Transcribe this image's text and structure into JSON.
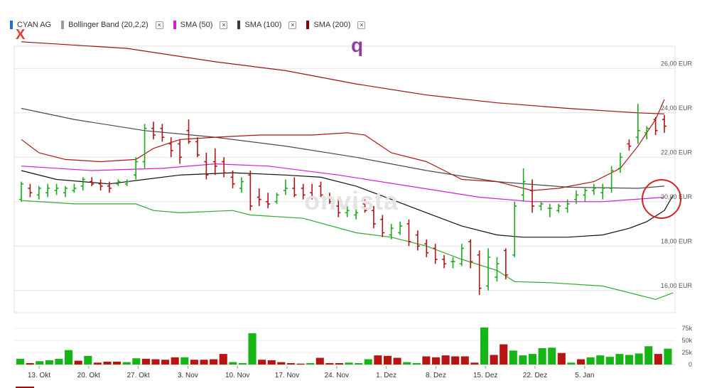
{
  "legend": [
    {
      "label": "CYAN AG",
      "color": "#1f6fd1",
      "closable": false
    },
    {
      "label": "Bollinger Band (20,2,2)",
      "color": "#9e9e9e",
      "closable": true
    },
    {
      "label": "SMA (50)",
      "color": "#d61ad6",
      "closable": true
    },
    {
      "label": "SMA (100)",
      "color": "#3a3a3a",
      "closable": true
    },
    {
      "label": "SMA (200)",
      "color": "#8b0000",
      "closable": true
    }
  ],
  "close_symbol": "×",
  "annotations": {
    "x_mark": "X",
    "q_mark": "q"
  },
  "watermark": "onvista",
  "chart_data": {
    "type": "ohlc",
    "y_axis": {
      "unit": "EUR",
      "ticks": [
        "26,00 EUR",
        "24,00 EUR",
        "22,00 EUR",
        "20,00 EUR",
        "18,00 EUR",
        "16,00 EUR"
      ],
      "range": [
        15.0,
        27.0
      ]
    },
    "volume_axis": {
      "ticks": [
        "75k",
        "50k",
        "25k",
        "0"
      ],
      "range": [
        0,
        90000
      ]
    },
    "x_labels": [
      "13. Okt",
      "20. Okt",
      "27. Okt",
      "3. Nov",
      "10. Nov",
      "17. Nov",
      "24. Nov",
      "1. Dez",
      "8. Dez",
      "15. Dez",
      "22. Dez",
      "5. Jan"
    ],
    "bars": [
      {
        "o": 20.1,
        "h": 20.9,
        "l": 20.0,
        "c": 20.8
      },
      {
        "o": 20.6,
        "h": 20.8,
        "l": 20.2,
        "c": 20.4
      },
      {
        "o": 20.3,
        "h": 20.7,
        "l": 20.1,
        "c": 20.6
      },
      {
        "o": 20.4,
        "h": 20.8,
        "l": 20.2,
        "c": 20.6
      },
      {
        "o": 20.5,
        "h": 20.8,
        "l": 20.3,
        "c": 20.6
      },
      {
        "o": 20.4,
        "h": 20.7,
        "l": 20.2,
        "c": 20.6
      },
      {
        "o": 20.5,
        "h": 20.8,
        "l": 20.4,
        "c": 20.6
      },
      {
        "o": 20.7,
        "h": 21.1,
        "l": 20.5,
        "c": 21.0
      },
      {
        "o": 20.9,
        "h": 21.1,
        "l": 20.7,
        "c": 20.8
      },
      {
        "o": 20.8,
        "h": 21.0,
        "l": 20.5,
        "c": 20.7
      },
      {
        "o": 20.7,
        "h": 20.9,
        "l": 20.4,
        "c": 20.6
      },
      {
        "o": 20.8,
        "h": 21.0,
        "l": 20.7,
        "c": 20.9
      },
      {
        "o": 20.8,
        "h": 21.0,
        "l": 20.7,
        "c": 20.9
      },
      {
        "o": 21.2,
        "h": 22.0,
        "l": 21.0,
        "c": 21.8
      },
      {
        "o": 21.8,
        "h": 23.5,
        "l": 21.5,
        "c": 23.3
      },
      {
        "o": 23.3,
        "h": 23.6,
        "l": 22.8,
        "c": 23.0
      },
      {
        "o": 23.3,
        "h": 23.5,
        "l": 22.7,
        "c": 22.9
      },
      {
        "o": 22.6,
        "h": 22.9,
        "l": 22.0,
        "c": 22.3
      },
      {
        "o": 22.6,
        "h": 22.8,
        "l": 21.7,
        "c": 22.0
      },
      {
        "o": 23.2,
        "h": 23.7,
        "l": 22.6,
        "c": 22.7
      },
      {
        "o": 22.7,
        "h": 22.9,
        "l": 22.0,
        "c": 22.1
      },
      {
        "o": 21.8,
        "h": 22.2,
        "l": 21.0,
        "c": 21.2
      },
      {
        "o": 21.8,
        "h": 22.4,
        "l": 21.2,
        "c": 21.6
      },
      {
        "o": 21.8,
        "h": 22.0,
        "l": 21.1,
        "c": 21.3
      },
      {
        "o": 21.1,
        "h": 21.4,
        "l": 20.6,
        "c": 20.8
      },
      {
        "o": 20.6,
        "h": 21.1,
        "l": 20.4,
        "c": 20.9
      },
      {
        "o": 21.2,
        "h": 21.4,
        "l": 19.6,
        "c": 19.8
      },
      {
        "o": 20.2,
        "h": 20.6,
        "l": 19.8,
        "c": 20.1
      },
      {
        "o": 20.0,
        "h": 20.4,
        "l": 19.7,
        "c": 19.9
      },
      {
        "o": 20.0,
        "h": 20.4,
        "l": 19.9,
        "c": 20.3
      },
      {
        "o": 20.5,
        "h": 21.0,
        "l": 20.3,
        "c": 20.6
      },
      {
        "o": 20.6,
        "h": 21.1,
        "l": 20.2,
        "c": 20.3
      },
      {
        "o": 20.6,
        "h": 20.8,
        "l": 20.1,
        "c": 20.3
      },
      {
        "o": 20.4,
        "h": 20.8,
        "l": 20.1,
        "c": 20.2
      },
      {
        "o": 20.7,
        "h": 20.9,
        "l": 20.2,
        "c": 20.3
      },
      {
        "o": 20.2,
        "h": 20.4,
        "l": 19.9,
        "c": 20.0
      },
      {
        "o": 19.8,
        "h": 20.2,
        "l": 19.3,
        "c": 19.5
      },
      {
        "o": 19.5,
        "h": 19.8,
        "l": 19.3,
        "c": 19.6
      },
      {
        "o": 19.4,
        "h": 19.7,
        "l": 19.2,
        "c": 19.5
      },
      {
        "o": 19.9,
        "h": 20.1,
        "l": 19.5,
        "c": 19.6
      },
      {
        "o": 19.6,
        "h": 19.8,
        "l": 18.8,
        "c": 19.0
      },
      {
        "o": 19.2,
        "h": 19.4,
        "l": 18.4,
        "c": 18.6
      },
      {
        "o": 18.5,
        "h": 19.0,
        "l": 18.3,
        "c": 18.8
      },
      {
        "o": 18.6,
        "h": 19.1,
        "l": 18.5,
        "c": 18.9
      },
      {
        "o": 19.0,
        "h": 19.2,
        "l": 18.0,
        "c": 18.2
      },
      {
        "o": 18.5,
        "h": 18.7,
        "l": 17.8,
        "c": 18.0
      },
      {
        "o": 18.1,
        "h": 18.3,
        "l": 17.5,
        "c": 17.7
      },
      {
        "o": 17.9,
        "h": 18.1,
        "l": 17.2,
        "c": 17.4
      },
      {
        "o": 17.4,
        "h": 17.6,
        "l": 17.0,
        "c": 17.2
      },
      {
        "o": 17.3,
        "h": 17.5,
        "l": 17.0,
        "c": 17.3
      },
      {
        "o": 17.2,
        "h": 18.1,
        "l": 17.1,
        "c": 17.9
      },
      {
        "o": 18.2,
        "h": 18.3,
        "l": 17.0,
        "c": 17.3
      },
      {
        "o": 17.6,
        "h": 17.8,
        "l": 15.8,
        "c": 16.1
      },
      {
        "o": 16.2,
        "h": 17.9,
        "l": 16.0,
        "c": 17.5
      },
      {
        "o": 16.6,
        "h": 17.5,
        "l": 16.4,
        "c": 17.2
      },
      {
        "o": 17.8,
        "h": 17.9,
        "l": 16.5,
        "c": 16.7
      },
      {
        "o": 17.6,
        "h": 20.0,
        "l": 17.5,
        "c": 19.8
      },
      {
        "o": 20.3,
        "h": 21.5,
        "l": 20.0,
        "c": 20.9
      },
      {
        "o": 20.5,
        "h": 21.0,
        "l": 19.5,
        "c": 19.8
      },
      {
        "o": 19.8,
        "h": 20.0,
        "l": 19.6,
        "c": 19.9
      },
      {
        "o": 19.7,
        "h": 19.9,
        "l": 19.3,
        "c": 19.7
      },
      {
        "o": 19.6,
        "h": 19.9,
        "l": 19.5,
        "c": 19.8
      },
      {
        "o": 19.7,
        "h": 20.1,
        "l": 19.5,
        "c": 19.9
      },
      {
        "o": 20.1,
        "h": 20.5,
        "l": 19.9,
        "c": 20.3
      },
      {
        "o": 20.3,
        "h": 20.6,
        "l": 20.0,
        "c": 20.5
      },
      {
        "o": 20.5,
        "h": 20.8,
        "l": 20.3,
        "c": 20.6
      },
      {
        "o": 20.4,
        "h": 20.8,
        "l": 20.1,
        "c": 20.6
      },
      {
        "o": 20.6,
        "h": 21.6,
        "l": 20.4,
        "c": 21.4
      },
      {
        "o": 21.5,
        "h": 22.2,
        "l": 21.3,
        "c": 22.0
      },
      {
        "o": 22.6,
        "h": 22.8,
        "l": 22.3,
        "c": 22.5
      },
      {
        "o": 22.9,
        "h": 24.4,
        "l": 22.6,
        "c": 23.2
      },
      {
        "o": 23.1,
        "h": 23.4,
        "l": 22.8,
        "c": 23.3
      },
      {
        "o": 23.7,
        "h": 23.8,
        "l": 23.0,
        "c": 23.2
      },
      {
        "o": 23.7,
        "h": 23.9,
        "l": 23.1,
        "c": 23.4
      }
    ],
    "volume": [
      {
        "v": 12000,
        "up": true
      },
      {
        "v": 3000,
        "up": false
      },
      {
        "v": 7000,
        "up": true
      },
      {
        "v": 9000,
        "up": true
      },
      {
        "v": 12000,
        "up": true
      },
      {
        "v": 30000,
        "up": true
      },
      {
        "v": 8000,
        "up": false
      },
      {
        "v": 18000,
        "up": true
      },
      {
        "v": 4000,
        "up": false
      },
      {
        "v": 6000,
        "up": false
      },
      {
        "v": 6000,
        "up": false
      },
      {
        "v": 5000,
        "up": true
      },
      {
        "v": 13000,
        "up": true
      },
      {
        "v": 12000,
        "up": false
      },
      {
        "v": 11000,
        "up": false
      },
      {
        "v": 10000,
        "up": false
      },
      {
        "v": 15000,
        "up": false
      },
      {
        "v": 15000,
        "up": true
      },
      {
        "v": 10000,
        "up": false
      },
      {
        "v": 10000,
        "up": false
      },
      {
        "v": 11000,
        "up": false
      },
      {
        "v": 22000,
        "up": false
      },
      {
        "v": 5000,
        "up": true
      },
      {
        "v": 3000,
        "up": true
      },
      {
        "v": 65000,
        "up": true
      },
      {
        "v": 10000,
        "up": false
      },
      {
        "v": 9000,
        "up": false
      },
      {
        "v": 5000,
        "up": false
      },
      {
        "v": 3000,
        "up": false
      },
      {
        "v": 2000,
        "up": false
      },
      {
        "v": 3000,
        "up": true
      },
      {
        "v": 14000,
        "up": false
      },
      {
        "v": 3000,
        "up": false
      },
      {
        "v": 3000,
        "up": false
      },
      {
        "v": 4000,
        "up": true
      },
      {
        "v": 3000,
        "up": true
      },
      {
        "v": 11000,
        "up": true
      },
      {
        "v": 19000,
        "up": false
      },
      {
        "v": 18000,
        "up": false
      },
      {
        "v": 14000,
        "up": false
      },
      {
        "v": 5000,
        "up": true
      },
      {
        "v": 3000,
        "up": true
      },
      {
        "v": 17000,
        "up": false
      },
      {
        "v": 15000,
        "up": false
      },
      {
        "v": 19000,
        "up": false
      },
      {
        "v": 17000,
        "up": false
      },
      {
        "v": 17000,
        "up": false
      },
      {
        "v": 4000,
        "up": false
      },
      {
        "v": 77000,
        "up": true
      },
      {
        "v": 20000,
        "up": false
      },
      {
        "v": 42000,
        "up": false
      },
      {
        "v": 29000,
        "up": true
      },
      {
        "v": 19000,
        "up": true
      },
      {
        "v": 22000,
        "up": true
      },
      {
        "v": 34000,
        "up": true
      },
      {
        "v": 35000,
        "up": true
      },
      {
        "v": 24000,
        "up": false
      },
      {
        "v": 4000,
        "up": true
      },
      {
        "v": 11000,
        "up": false
      },
      {
        "v": 15000,
        "up": true
      },
      {
        "v": 19000,
        "up": true
      },
      {
        "v": 16000,
        "up": true
      },
      {
        "v": 22000,
        "up": true
      },
      {
        "v": 20000,
        "up": true
      },
      {
        "v": 23000,
        "up": true
      },
      {
        "v": 38000,
        "up": true
      },
      {
        "v": 22000,
        "up": false
      },
      {
        "v": 33000,
        "up": true
      }
    ],
    "series": [
      {
        "name": "SMA (200)",
        "color": "#9b1111",
        "values": [
          [
            0,
            27.2
          ],
          [
            12,
            26.9
          ],
          [
            22,
            26.3
          ],
          [
            30,
            25.9
          ],
          [
            38,
            25.3
          ],
          [
            46,
            24.8
          ],
          [
            54,
            24.45
          ],
          [
            62,
            24.2
          ],
          [
            70,
            24.0
          ],
          [
            73,
            23.95
          ]
        ]
      },
      {
        "name": "SMA (100)",
        "color": "#4a4a4a",
        "values": [
          [
            0,
            24.2
          ],
          [
            6,
            23.7
          ],
          [
            14,
            23.2
          ],
          [
            22,
            22.9
          ],
          [
            30,
            22.5
          ],
          [
            38,
            22.0
          ],
          [
            46,
            21.4
          ],
          [
            54,
            20.9
          ],
          [
            62,
            20.65
          ],
          [
            70,
            20.6
          ],
          [
            73,
            20.7
          ]
        ]
      },
      {
        "name": "SMA (50)",
        "color": "#d61ad6",
        "values": [
          [
            0,
            21.6
          ],
          [
            8,
            21.4
          ],
          [
            16,
            21.5
          ],
          [
            22,
            21.7
          ],
          [
            28,
            21.6
          ],
          [
            36,
            21.2
          ],
          [
            44,
            20.7
          ],
          [
            52,
            20.2
          ],
          [
            58,
            20.0
          ],
          [
            66,
            20.0
          ],
          [
            73,
            20.2
          ]
        ]
      },
      {
        "name": "Bollinger Band (20,2,2) upper",
        "color": "#b01515",
        "values": [
          [
            0,
            22.8
          ],
          [
            2,
            22.2
          ],
          [
            5,
            21.9
          ],
          [
            9,
            21.8
          ],
          [
            13,
            21.9
          ],
          [
            15,
            22.4
          ],
          [
            18,
            22.8
          ],
          [
            22,
            22.9
          ],
          [
            27,
            23.0
          ],
          [
            33,
            23.0
          ],
          [
            37,
            23.1
          ],
          [
            39,
            23.0
          ],
          [
            42,
            22.2
          ],
          [
            46,
            21.8
          ],
          [
            50,
            21.0
          ],
          [
            54,
            20.9
          ],
          [
            58,
            20.5
          ],
          [
            61,
            20.6
          ],
          [
            65,
            20.9
          ],
          [
            68,
            21.5
          ],
          [
            70,
            22.5
          ],
          [
            72,
            23.7
          ],
          [
            73,
            24.6
          ]
        ]
      },
      {
        "name": "Bollinger Band (20,2,2) middle",
        "color": "#111111",
        "values": [
          [
            0,
            21.4
          ],
          [
            4,
            21.0
          ],
          [
            10,
            20.8
          ],
          [
            14,
            21.0
          ],
          [
            18,
            21.2
          ],
          [
            24,
            21.3
          ],
          [
            30,
            21.2
          ],
          [
            34,
            21.1
          ],
          [
            38,
            20.7
          ],
          [
            42,
            20.1
          ],
          [
            46,
            19.5
          ],
          [
            50,
            18.9
          ],
          [
            54,
            18.5
          ],
          [
            57,
            18.4
          ],
          [
            62,
            18.4
          ],
          [
            66,
            18.5
          ],
          [
            69,
            18.8
          ],
          [
            71,
            19.1
          ],
          [
            73,
            19.6
          ],
          [
            74,
            20.3
          ]
        ]
      },
      {
        "name": "Bollinger Band (20,2,2) lower",
        "color": "#2eaa2e",
        "values": [
          [
            0,
            20.05
          ],
          [
            6,
            19.9
          ],
          [
            13,
            19.9
          ],
          [
            15,
            19.6
          ],
          [
            18,
            19.5
          ],
          [
            24,
            19.6
          ],
          [
            26,
            19.4
          ],
          [
            32,
            19.25
          ],
          [
            38,
            18.6
          ],
          [
            42,
            18.4
          ],
          [
            46,
            18.0
          ],
          [
            50,
            17.4
          ],
          [
            54,
            16.9
          ],
          [
            56,
            16.4
          ],
          [
            60,
            16.35
          ],
          [
            66,
            16.2
          ],
          [
            70,
            15.8
          ],
          [
            72,
            15.6
          ],
          [
            74,
            15.9
          ]
        ]
      }
    ]
  }
}
